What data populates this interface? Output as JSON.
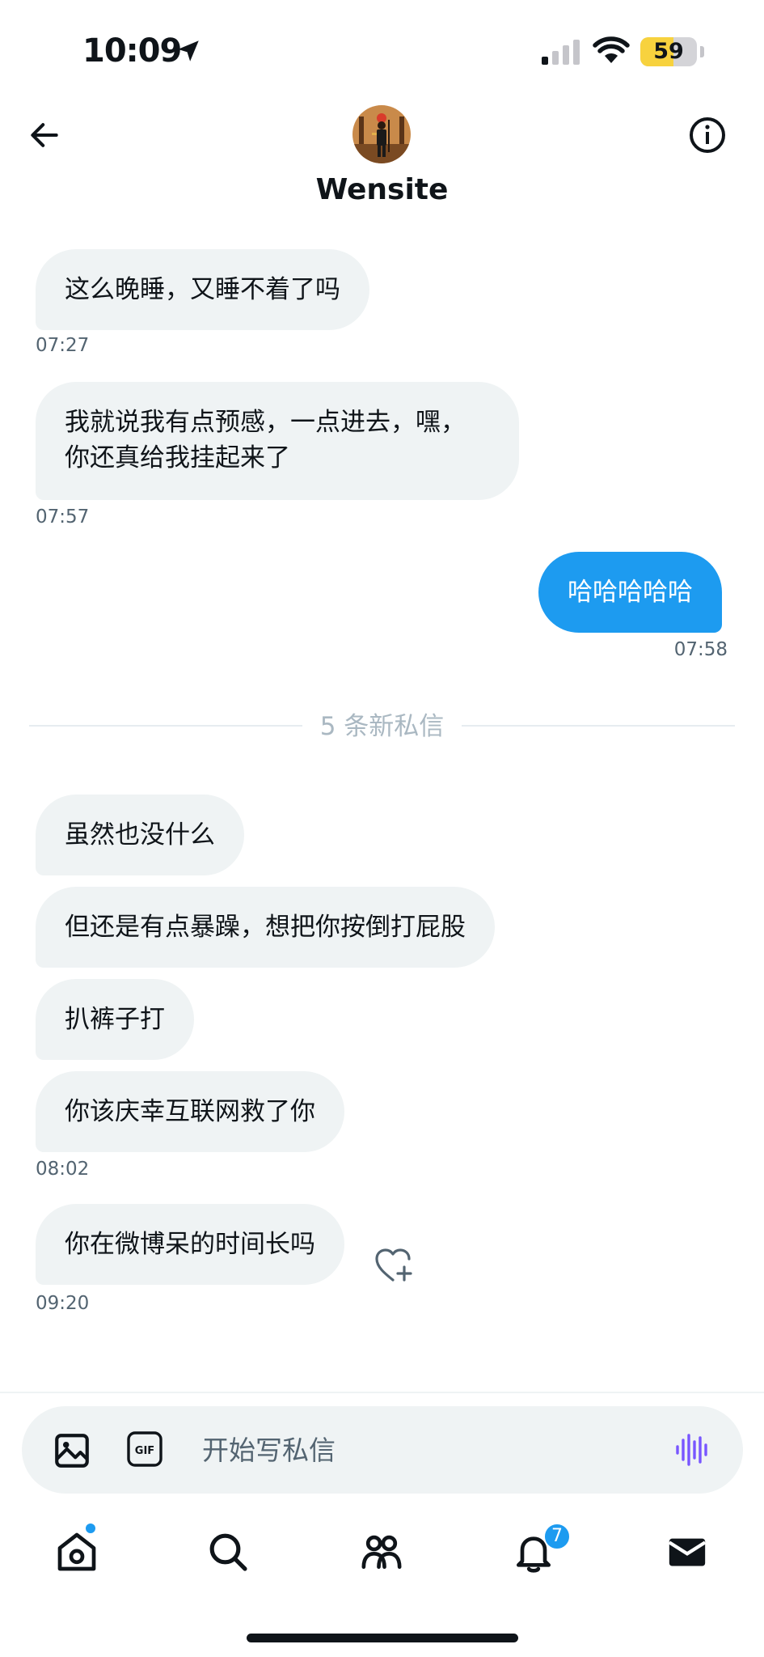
{
  "status_bar": {
    "time": "10:09",
    "battery_percent": "59",
    "battery_level": 0.59
  },
  "header": {
    "contact_name": "Wensite"
  },
  "messages": [
    {
      "text": "这么晚睡，又睡不着了吗",
      "time": "07:27"
    },
    {
      "text": "我就说我有点预感，一点进去，嘿，你还真给我挂起来了",
      "time": "07:57"
    },
    {
      "text": "哈哈哈哈哈",
      "time": "07:58"
    },
    {
      "text": "虽然也没什么"
    },
    {
      "text": "但还是有点暴躁，想把你按倒打屁股"
    },
    {
      "text": "扒裤子打"
    },
    {
      "text": "你该庆幸互联网救了你",
      "time": "08:02"
    },
    {
      "text": "你在微博呆的时间长吗",
      "time": "09:20"
    }
  ],
  "divider": {
    "label": "5 条新私信"
  },
  "composer": {
    "placeholder": "开始写私信",
    "gif_label": "GIF"
  },
  "tab_bar": {
    "notifications_badge": "7"
  },
  "colors": {
    "accent": "#1d9bf0",
    "bubble_in": "#eff3f4",
    "voice": "#7856ff",
    "battery": "#f7d23e"
  }
}
